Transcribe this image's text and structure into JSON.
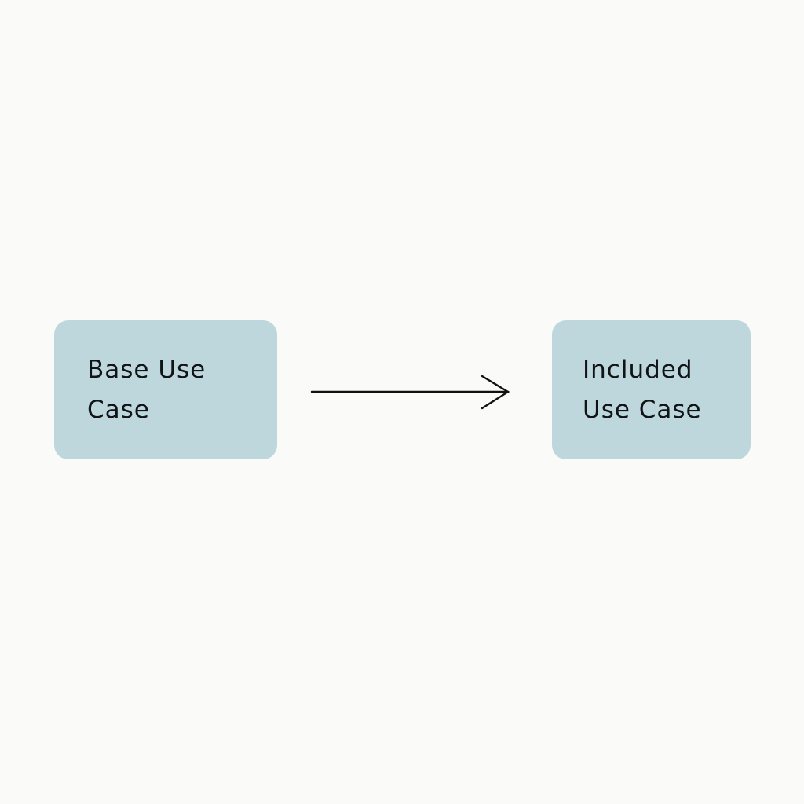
{
  "diagram": {
    "type": "use-case-include",
    "nodes": [
      {
        "id": "base",
        "label_lines": [
          "Base Use",
          "Case"
        ],
        "fill": "#bdd7dc"
      },
      {
        "id": "included",
        "label_lines": [
          "Included",
          "Use Case"
        ],
        "fill": "#bdd7dc"
      }
    ],
    "edges": [
      {
        "from": "base",
        "to": "included",
        "style": "solid",
        "head": "open-arrow",
        "color": "#111111",
        "label": ""
      }
    ],
    "background": "#fafaf8"
  }
}
